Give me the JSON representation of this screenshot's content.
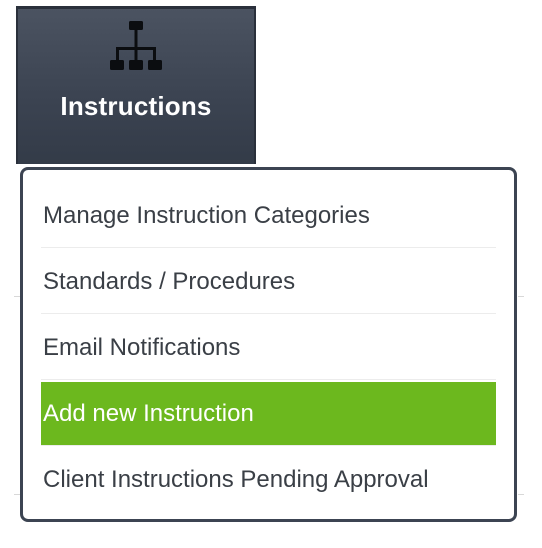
{
  "menu_button": {
    "label": "Instructions",
    "icon": "sitemap-icon",
    "background": "#3c4452"
  },
  "dropdown": {
    "items": [
      {
        "label": "Manage Instruction Categories",
        "active": false
      },
      {
        "label": "Standards / Procedures",
        "active": false
      },
      {
        "label": "Email Notifications",
        "active": false
      },
      {
        "label": "Add new Instruction",
        "active": true
      },
      {
        "label": "Client Instructions Pending Approval",
        "active": false
      }
    ],
    "active_color": "#6cb81e",
    "border_color": "#3c4452"
  }
}
